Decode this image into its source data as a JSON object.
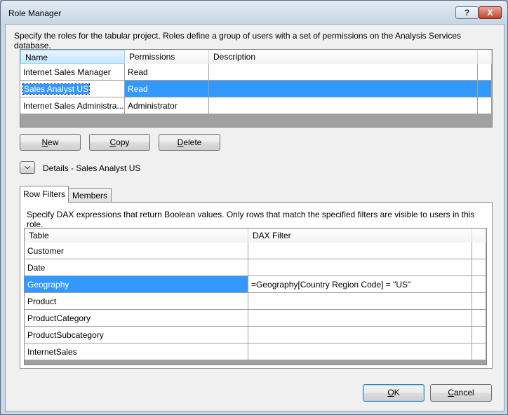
{
  "window": {
    "title": "Role Manager",
    "help_glyph": "?",
    "close_glyph": "X"
  },
  "intro_text": "Specify the roles for the tabular project. Roles define a group of users with a set of permissions on the Analysis Services database.",
  "roles_table": {
    "columns": [
      "Name",
      "Permissions",
      "Description"
    ],
    "rows": [
      {
        "name": "Internet Sales Manager",
        "permissions": "Read",
        "description": ""
      },
      {
        "name": "Sales Analyst US",
        "permissions": "Read",
        "description": ""
      },
      {
        "name": "Internet Sales Administra...",
        "permissions": "Administrator",
        "description": ""
      }
    ],
    "selected_index": 1
  },
  "buttons": {
    "new": "New",
    "copy": "Copy",
    "delete": "Delete",
    "ok": "OK",
    "cancel": "Cancel"
  },
  "details": {
    "label": "Details - Sales Analyst US",
    "toggle_icon": "chevron-double-down-icon"
  },
  "tabs": [
    {
      "label": "Row Filters",
      "active": true
    },
    {
      "label": "Members",
      "active": false
    }
  ],
  "row_filters": {
    "instructions": "Specify DAX expressions that return Boolean values. Only rows that match the specified filters are visible to users in this role.",
    "columns": [
      "Table",
      "DAX Filter"
    ],
    "rows": [
      {
        "table": "Customer",
        "filter": ""
      },
      {
        "table": "Date",
        "filter": ""
      },
      {
        "table": "Geography",
        "filter": "=Geography[Country Region Code] = \"US\""
      },
      {
        "table": "Product",
        "filter": ""
      },
      {
        "table": "ProductCategory",
        "filter": ""
      },
      {
        "table": "ProductSubcategory",
        "filter": ""
      },
      {
        "table": "InternetSales",
        "filter": ""
      }
    ],
    "selected_index": 2
  },
  "colors": {
    "selection": "#3399ff",
    "grid_line": "#a0a0a0",
    "dialog_bg": "#f0f0f0"
  }
}
